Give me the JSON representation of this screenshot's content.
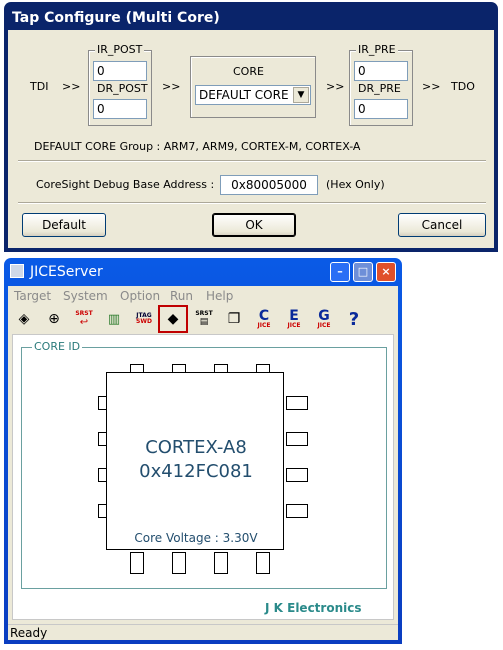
{
  "dialog": {
    "title": "Tap Configure (Multi Core)",
    "tdi": "TDI",
    "tdo": "TDO",
    "arrow": ">>",
    "ir_post": {
      "label": "IR_POST",
      "value": "0"
    },
    "dr_post": {
      "label": "DR_POST",
      "value": "0"
    },
    "ir_pre": {
      "label": "IR_PRE",
      "value": "0"
    },
    "dr_pre": {
      "label": "DR_PRE",
      "value": "0"
    },
    "core": {
      "label": "CORE",
      "selected": "DEFAULT CORE"
    },
    "group_text": "DEFAULT CORE Group : ARM7, ARM9, CORTEX-M, CORTEX-A",
    "coresight": {
      "label": "CoreSight Debug Base Address :",
      "value": "0x80005000",
      "hint": "(Hex Only)"
    },
    "buttons": {
      "default": "Default",
      "ok": "OK",
      "cancel": "Cancel"
    }
  },
  "window": {
    "title": "JICEServer",
    "menu": [
      "Target",
      "System",
      "Option",
      "Run",
      "Help"
    ],
    "toolbar": {
      "srst": "SRST",
      "jtag": "JTAG",
      "swd": "SWD",
      "jice": "JICE",
      "letters": [
        "C",
        "E",
        "G"
      ],
      "help": "?"
    },
    "core_id_label": "CORE ID",
    "chip_name": "CORTEX-A8",
    "chip_id": "0x412FC081",
    "voltage": "Core Voltage : 3.30V",
    "brand": "J K Electronics",
    "status": "Ready"
  },
  "colors": {
    "title_bar": "#0a246a",
    "xp_blue": "#0054e3",
    "chip_text": "#234e6e",
    "brand": "#2a8a8a"
  }
}
